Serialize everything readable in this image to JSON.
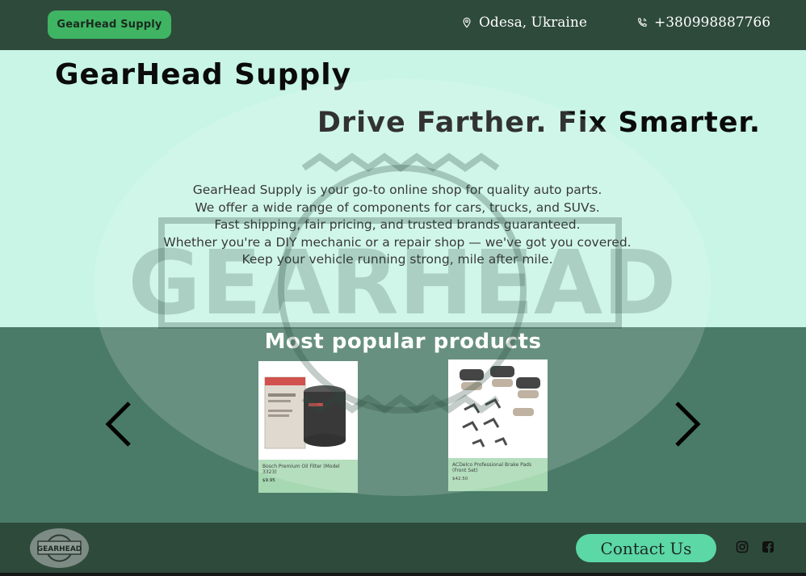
{
  "header": {
    "brand_badge": "GearHead Supply",
    "location": "Odesa, Ukraine",
    "phone": "+380998887766",
    "location_icon": "map-pin-icon",
    "phone_icon": "phone-icon"
  },
  "hero": {
    "title": "GearHead Supply",
    "tagline": "Drive Farther. Fix Smarter.",
    "lines": [
      "GearHead Supply is your go-to online shop for quality auto parts.",
      "We offer a wide range of components for cars, trucks, and SUVs.",
      "Fast shipping, fair pricing, and trusted brands guaranteed.",
      "Whether you're a DIY mechanic or a repair shop — we've got you covered.",
      "Keep your vehicle running strong, mile after mile."
    ],
    "watermark_text": "GEARHEAD"
  },
  "products": {
    "title": "Most popular products",
    "items": [
      {
        "name": "Bosch Premium Oil Filter (Model 3323)",
        "price": "$9.95",
        "image": "oil-filter"
      },
      {
        "name": "ACDelco Professional Brake Pads (Front Set)",
        "price": "$42.50",
        "image": "brake-pads"
      }
    ],
    "prev_icon": "chevron-left-icon",
    "next_icon": "chevron-right-icon"
  },
  "footer": {
    "logo_text": "GEARHEAD",
    "contact_button": "Contact Us",
    "social_icons": [
      "instagram-icon",
      "facebook-icon"
    ]
  },
  "colors": {
    "header_bg": "#2e4a3b",
    "hero_bg": "#c8f5e6",
    "products_bg": "#4a7b68",
    "badge": "#3fb463",
    "contact_button": "#5cd7a6",
    "card_bg": "#a6d8b1"
  }
}
